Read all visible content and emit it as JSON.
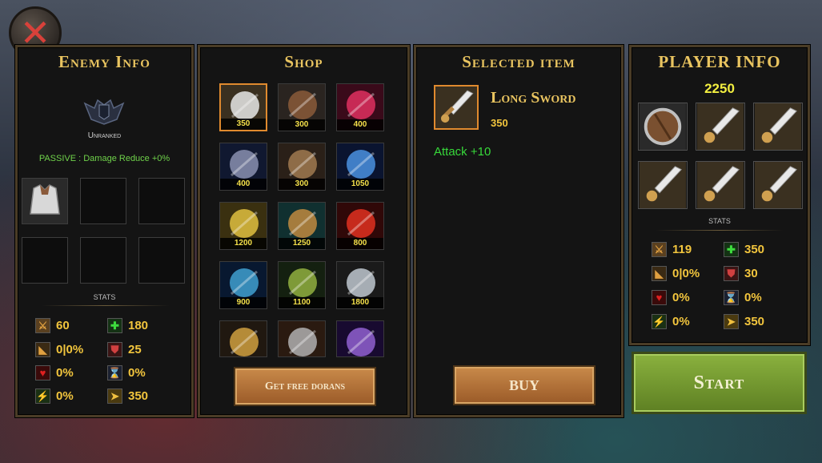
{
  "close": {
    "label": "✕"
  },
  "enemy": {
    "title": "Enemy Info",
    "rank": "Unranked",
    "passive": "PASSIVE : Damage Reduce +0%",
    "stats_label": "STATS",
    "stats": {
      "attack": "60",
      "health": "180",
      "crit": "0|0%",
      "armor": "25",
      "lifesteal": "0%",
      "cooldown": "0%",
      "attack_speed": "0%",
      "move_speed": "350"
    }
  },
  "shop": {
    "title": "Shop",
    "items": [
      {
        "name": "sword",
        "price": "350"
      },
      {
        "name": "chest",
        "price": "300"
      },
      {
        "name": "gem",
        "price": "400"
      },
      {
        "name": "gauntlet",
        "price": "400"
      },
      {
        "name": "boots",
        "price": "300"
      },
      {
        "name": "staff",
        "price": "1050"
      },
      {
        "name": "helm",
        "price": "1200"
      },
      {
        "name": "shield",
        "price": "1250"
      },
      {
        "name": "orb",
        "price": "800"
      },
      {
        "name": "tome",
        "price": "900"
      },
      {
        "name": "bow",
        "price": "1100"
      },
      {
        "name": "anvil",
        "price": "1800"
      },
      {
        "name": "scythe",
        "price": ""
      },
      {
        "name": "hammer",
        "price": ""
      },
      {
        "name": "blade",
        "price": ""
      }
    ],
    "free_button": "Get free dorans"
  },
  "selected": {
    "title": "Selected item",
    "name": "Long Sword",
    "price": "350",
    "effect": "Attack +10",
    "buy_button": "BUY"
  },
  "player": {
    "title": "PLAYER INFO",
    "gold": "2250",
    "stats_label": "STATS",
    "stats": {
      "attack": "119",
      "health": "350",
      "crit": "0|0%",
      "armor": "30",
      "lifesteal": "0%",
      "cooldown": "0%",
      "attack_speed": "0%",
      "move_speed": "350"
    }
  },
  "start_button": "Start",
  "colors": {
    "gold": "#f2c53d",
    "title": "#e9c460",
    "accent": "#e08a2e",
    "green": "#6fd24a"
  }
}
